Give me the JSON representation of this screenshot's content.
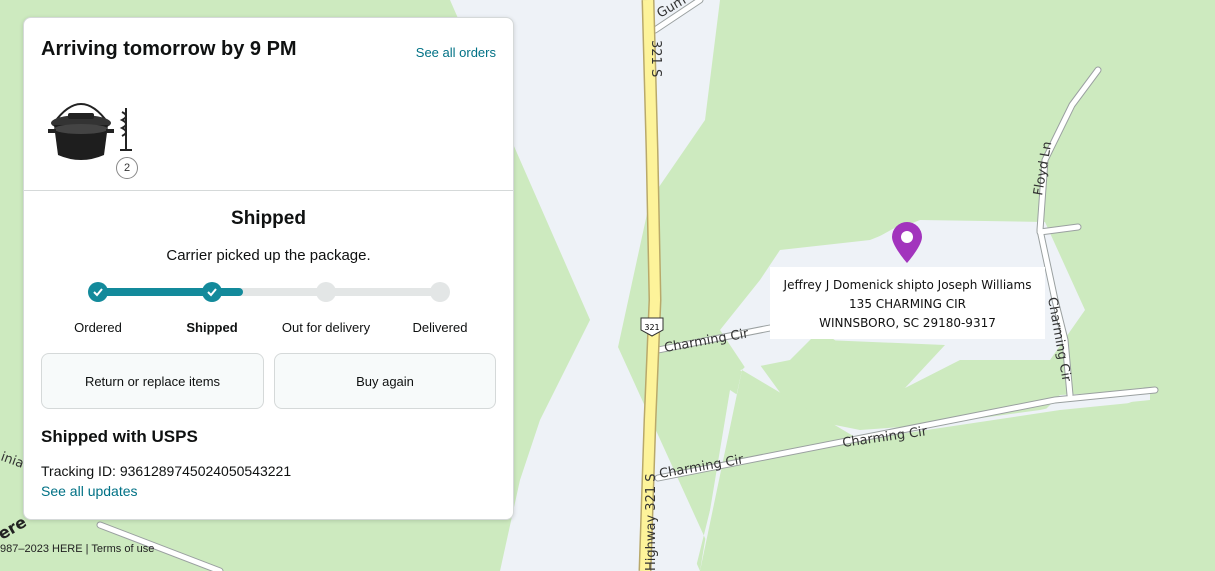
{
  "delivery": {
    "arriving": "Arriving tomorrow by 9 PM",
    "see_all_orders": "See all orders",
    "item_count": "2"
  },
  "status": {
    "title": "Shipped",
    "subtitle": "Carrier picked up the package.",
    "progress_fraction": 0.42,
    "steps": [
      "Ordered",
      "Shipped",
      "Out for delivery",
      "Delivered"
    ],
    "current_step": 1
  },
  "actions": {
    "return_label": "Return or replace items",
    "buy_again_label": "Buy again"
  },
  "shipping": {
    "carrier": "Shipped with USPS",
    "tracking": "Tracking ID: 9361289745024050543221",
    "see_updates": "See all updates"
  },
  "map": {
    "address_line1": "Jeffrey J Domenick shipto Joseph Williams",
    "address_line2": "135 CHARMING CIR",
    "address_line3": "WINNSBORO, SC 29180-9317",
    "road_labels": [
      "Charming Cir",
      "Charming Cir",
      "Charming Cir",
      "Charming Cir",
      "Floyd Ln",
      "Highway 321 S",
      "321 S",
      "321",
      "Gum",
      "inia"
    ],
    "copyright": "987–2023 HERE | ",
    "terms": "Terms of use",
    "here_logo": "ere",
    "pin_color": "#a234bd",
    "road_color": "#fdf39a"
  }
}
